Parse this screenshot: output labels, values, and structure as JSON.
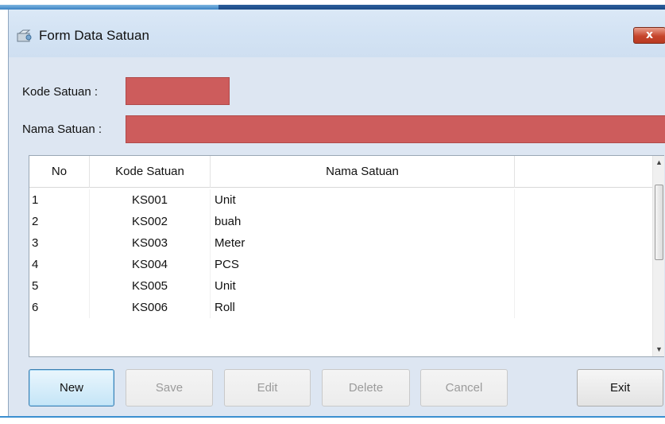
{
  "window": {
    "title": "Form Data Satuan",
    "close_label": "x"
  },
  "form": {
    "kode_label": "Kode Satuan :",
    "nama_label": "Nama Satuan :",
    "kode_value": "",
    "nama_value": "",
    "field_color": "#cd5c5c"
  },
  "grid": {
    "columns": [
      "No",
      "Kode Satuan",
      "Nama Satuan"
    ],
    "rows": [
      {
        "no": "1",
        "kode": "KS001",
        "nama": "Unit"
      },
      {
        "no": "2",
        "kode": "KS002",
        "nama": "buah"
      },
      {
        "no": "3",
        "kode": "KS003",
        "nama": "Meter"
      },
      {
        "no": "4",
        "kode": "KS004",
        "nama": "PCS"
      },
      {
        "no": "5",
        "kode": "KS005",
        "nama": "Unit"
      },
      {
        "no": "6",
        "kode": "KS006",
        "nama": "Roll"
      }
    ],
    "scroll_up_icon": "up-arrow-icon",
    "scroll_down_icon": "down-arrow-icon"
  },
  "buttons": {
    "new": "New",
    "save": "Save",
    "edit": "Edit",
    "delete": "Delete",
    "cancel": "Cancel",
    "exit": "Exit"
  },
  "icons": {
    "titlebar": "app-icon",
    "close": "close-icon"
  }
}
